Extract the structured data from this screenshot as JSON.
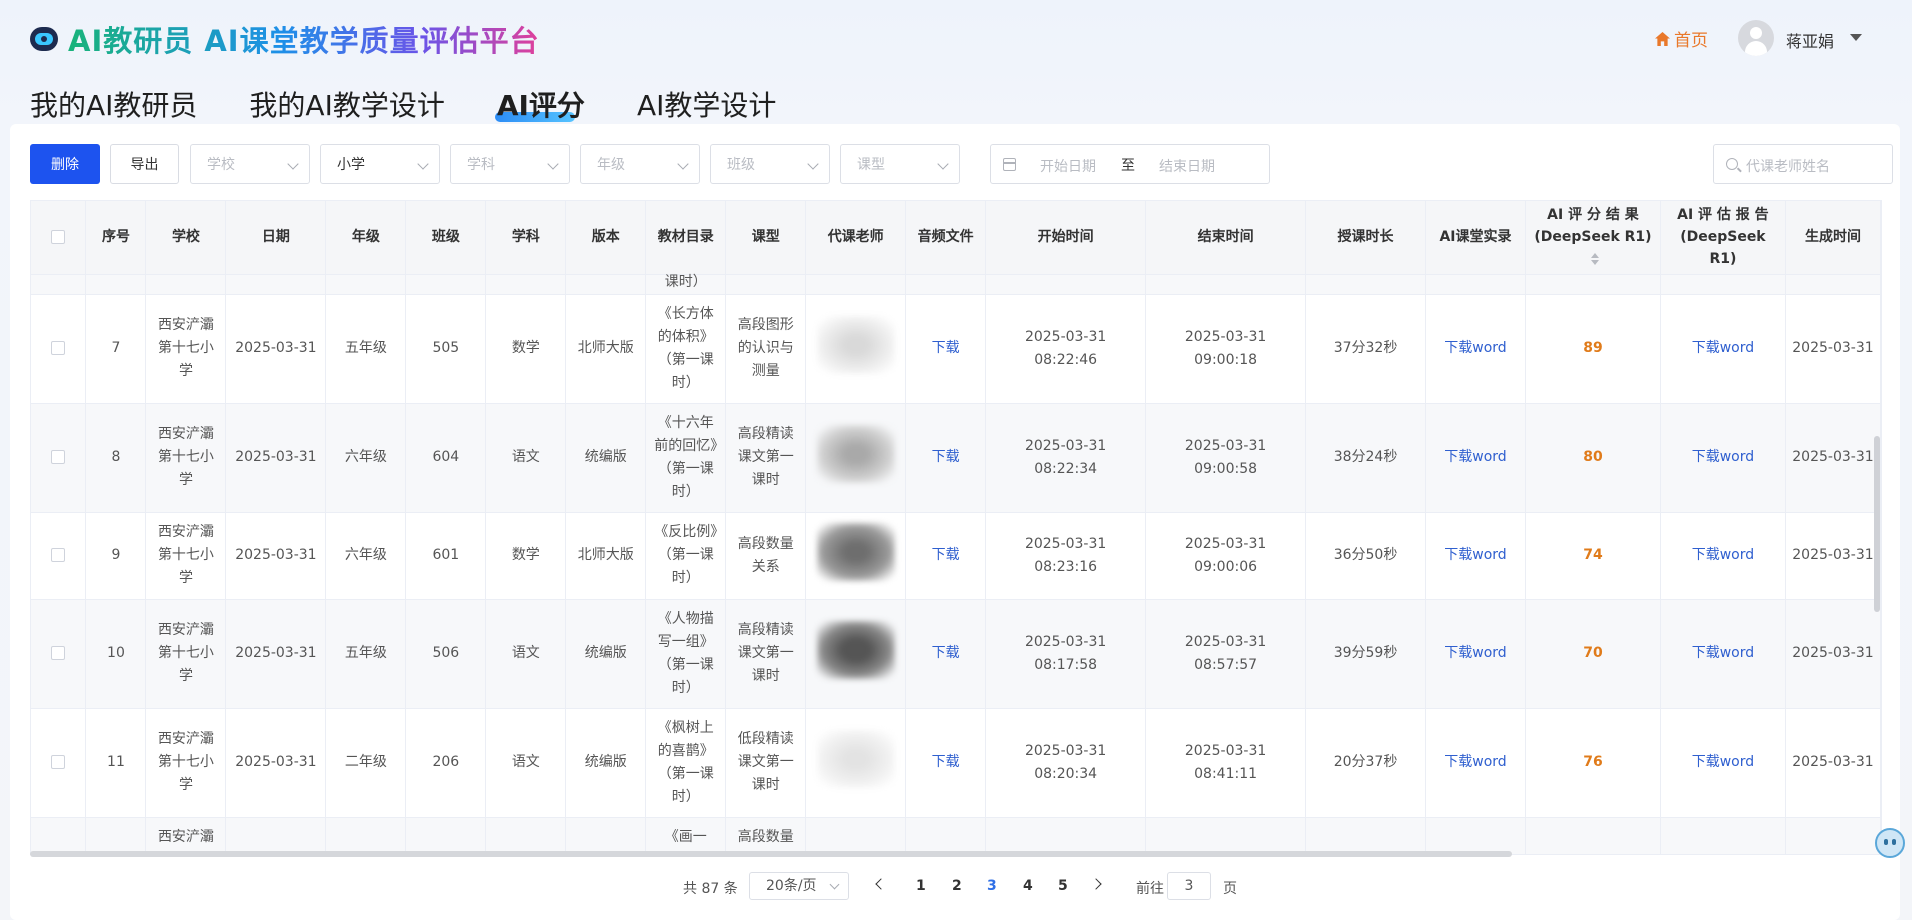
{
  "header": {
    "logo_text": "AI教研员 AI课堂教学质量评估平台",
    "home_label": "首页",
    "username": "蒋亚娟"
  },
  "nav": {
    "tabs": [
      {
        "label": "我的AI教研员"
      },
      {
        "label": "我的AI教学设计"
      },
      {
        "label": "AI评分"
      },
      {
        "label": "AI教学设计"
      }
    ],
    "active": "AI评分"
  },
  "toolbar": {
    "delete_label": "删除",
    "export_label": "导出",
    "filters": [
      {
        "placeholder": "学校",
        "value": ""
      },
      {
        "placeholder": "小学",
        "value": "小学"
      },
      {
        "placeholder": "学科",
        "value": ""
      },
      {
        "placeholder": "年级",
        "value": ""
      },
      {
        "placeholder": "班级",
        "value": ""
      },
      {
        "placeholder": "课型",
        "value": ""
      }
    ],
    "date_start_placeholder": "开始日期",
    "date_separator": "至",
    "date_end_placeholder": "结束日期",
    "search_placeholder": "代课老师姓名"
  },
  "table": {
    "headers": [
      "序号",
      "学校",
      "日期",
      "年级",
      "班级",
      "学科",
      "版本",
      "教材目录",
      "课型",
      "代课老师",
      "音频文件",
      "开始时间",
      "结束时间",
      "授课时长",
      "AI课堂实录",
      "AI 评 分 结 果(DeepSeek R1)",
      "AI 评 估 报 告 (DeepSeek R1)",
      "生成时间"
    ],
    "partial_top_text": "课时）",
    "rows": [
      {
        "index": "7",
        "school": "西安浐灞第十七小学",
        "date": "2025-03-31",
        "grade": "五年级",
        "class": "505",
        "subject": "数学",
        "edition": "北师大版",
        "catalog": "《长方体的体积》（第一课时）",
        "type": "高段图形的认识与测量",
        "audio": "下载",
        "start": "2025-03-31 08:22:46",
        "end": "2025-03-31 09:00:18",
        "duration": "37分32秒",
        "record": "下载word",
        "score": "89",
        "report": "下载word",
        "generated": "2025-03-31"
      },
      {
        "index": "8",
        "school": "西安浐灞第十七小学",
        "date": "2025-03-31",
        "grade": "六年级",
        "class": "604",
        "subject": "语文",
        "edition": "统编版",
        "catalog": "《十六年前的回忆》（第一课时）",
        "type": "高段精读课文第一课时",
        "audio": "下载",
        "start": "2025-03-31 08:22:34",
        "end": "2025-03-31 09:00:58",
        "duration": "38分24秒",
        "record": "下载word",
        "score": "80",
        "report": "下载word",
        "generated": "2025-03-31"
      },
      {
        "index": "9",
        "school": "西安浐灞第十七小学",
        "date": "2025-03-31",
        "grade": "六年级",
        "class": "601",
        "subject": "数学",
        "edition": "北师大版",
        "catalog": "《反比例》（第一课时）",
        "type": "高段数量关系",
        "audio": "下载",
        "start": "2025-03-31 08:23:16",
        "end": "2025-03-31 09:00:06",
        "duration": "36分50秒",
        "record": "下载word",
        "score": "74",
        "report": "下载word",
        "generated": "2025-03-31"
      },
      {
        "index": "10",
        "school": "西安浐灞第十七小学",
        "date": "2025-03-31",
        "grade": "五年级",
        "class": "506",
        "subject": "语文",
        "edition": "统编版",
        "catalog": "《人物描写一组》（第一课时）",
        "type": "高段精读课文第一课时",
        "audio": "下载",
        "start": "2025-03-31 08:17:58",
        "end": "2025-03-31 08:57:57",
        "duration": "39分59秒",
        "record": "下载word",
        "score": "70",
        "report": "下载word",
        "generated": "2025-03-31"
      },
      {
        "index": "11",
        "school": "西安浐灞第十七小学",
        "date": "2025-03-31",
        "grade": "二年级",
        "class": "206",
        "subject": "语文",
        "edition": "统编版",
        "catalog": "《枫树上的喜鹊》（第一课时）",
        "type": "低段精读课文第一课时",
        "audio": "下载",
        "start": "2025-03-31 08:20:34",
        "end": "2025-03-31 08:41:11",
        "duration": "20分37秒",
        "record": "下载word",
        "score": "76",
        "report": "下载word",
        "generated": "2025-03-31"
      }
    ],
    "partial_row": {
      "school": "西安浐灞",
      "catalog": "《画一",
      "type": "高段数量"
    }
  },
  "pagination": {
    "total": "共 87 条",
    "page_size": "20条/页",
    "pages": [
      "1",
      "2",
      "3",
      "4",
      "5"
    ],
    "current_page": "3",
    "goto_label": "前往",
    "goto_value": "3",
    "goto_unit": "页"
  },
  "colors": {
    "primary": "#1d53ef",
    "link": "#2f5fcf",
    "score": "#e07b1a",
    "home": "#e9782a"
  },
  "icons": [
    "logo-icon",
    "home-icon",
    "avatar-icon",
    "caret-down-icon",
    "calendar-icon",
    "search-icon",
    "sort-icon",
    "chevron-left-icon",
    "chevron-right-icon",
    "chat-assistant-icon"
  ]
}
